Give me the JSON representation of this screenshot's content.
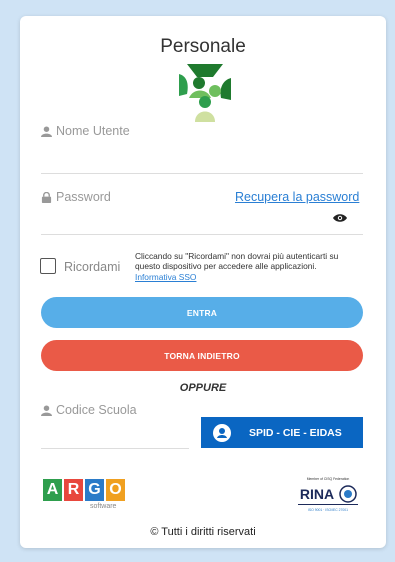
{
  "header": {
    "title": "Personale"
  },
  "login": {
    "username_label": "Nome Utente",
    "password_label": "Password",
    "recover_link": "Recupera la password",
    "remember_label": "Ricordami",
    "remember_note": "Cliccando su \"Ricordami\" non dovrai più autenticarti su questo dispositivo per accedere alle applicazioni.",
    "sso_link": "Informativa SSO",
    "enter_button": "ENTRA",
    "back_button": "TORNA INDIETRO"
  },
  "alt": {
    "or_label": "OPPURE",
    "school_code_label": "Codice Scuola",
    "spid_button": "SPID - CIE - EIDAS"
  },
  "branding": {
    "argo_letters": [
      "A",
      "R",
      "G",
      "O"
    ],
    "argo_colors": [
      "#2e9e4d",
      "#e8473d",
      "#2b7bc8",
      "#f0a020"
    ],
    "argo_sub": "software",
    "cert_top": "Member of CISQ Federation",
    "cert_name": "RINA",
    "cert_bottom": "ISO 9001 · ISO/IEC 27001"
  },
  "footer": {
    "copyright": "© Tutti i diritti riservati"
  }
}
